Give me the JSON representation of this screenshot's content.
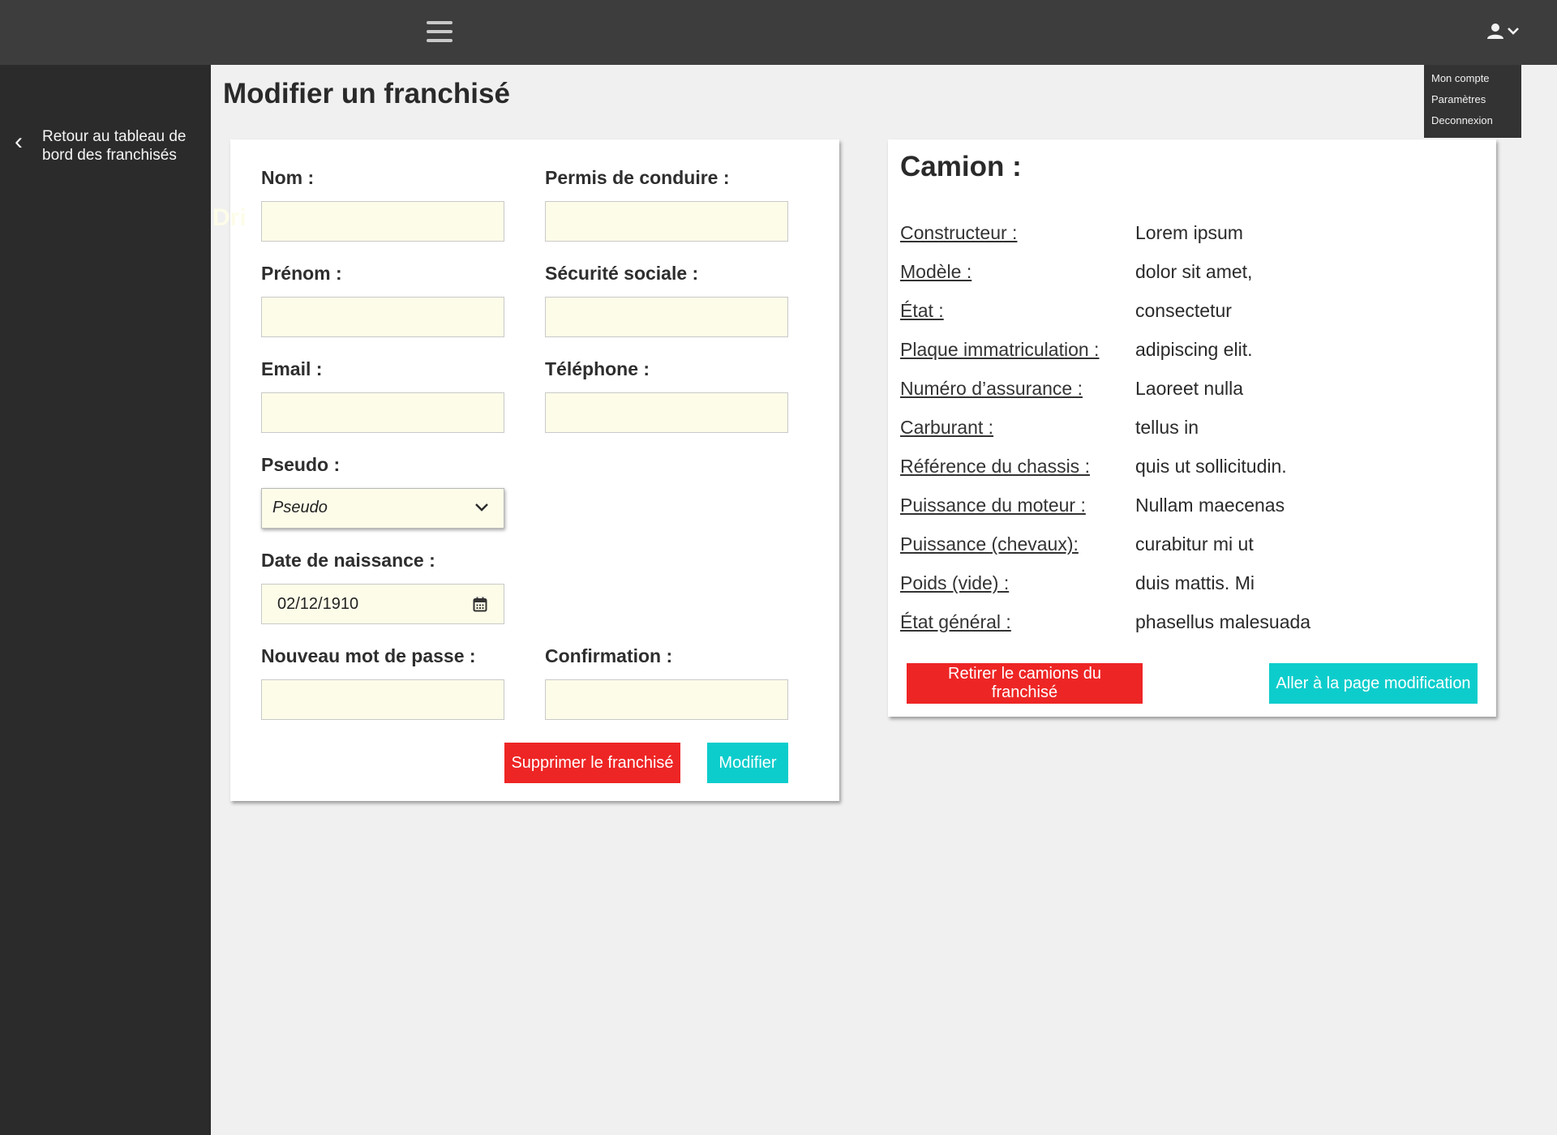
{
  "header": {
    "menu_icon": "hamburger-menu-icon",
    "account_icon": "user-icon"
  },
  "account_menu": {
    "items": [
      "Mon compte",
      "Paramètres",
      "Deconnexion"
    ]
  },
  "sidebar": {
    "back_icon": "chevron-left-icon",
    "back_link_line1": "Retour au tableau de",
    "back_link_line2": "bord des franchisés"
  },
  "page": {
    "title": "Modifier un franchisé",
    "ghost_text": "Dri"
  },
  "form": {
    "nom": {
      "label": "Nom :",
      "value": ""
    },
    "permis": {
      "label": "Permis de conduire :",
      "value": ""
    },
    "prenom": {
      "label": "Prénom :",
      "value": ""
    },
    "securite_sociale": {
      "label": "Sécurité sociale :",
      "value": ""
    },
    "email": {
      "label": "Email :",
      "value": ""
    },
    "telephone": {
      "label": "Téléphone :",
      "value": ""
    },
    "pseudo": {
      "label": "Pseudo :",
      "selected": "Pseudo"
    },
    "date_naissance": {
      "label": "Date de naissance :",
      "value": "02/12/1910"
    },
    "nouveau_mdp": {
      "label": "Nouveau mot de passe :",
      "value": ""
    },
    "confirmation": {
      "label": "Confirmation  :",
      "value": ""
    },
    "delete_label": "Supprimer le franchisé",
    "submit_label": "Modifier"
  },
  "truck": {
    "title": "Camion :",
    "specs": [
      {
        "label": "Constructeur :",
        "value": "Lorem ipsum"
      },
      {
        "label": "Modèle :",
        "value": "dolor sit amet,"
      },
      {
        "label": "État :",
        "value": "consectetur"
      },
      {
        "label": "Plaque immatriculation :",
        "value": "adipiscing elit."
      },
      {
        "label": "Numéro d’assurance :",
        "value": "Laoreet nulla"
      },
      {
        "label": "Carburant :",
        "value": "tellus in"
      },
      {
        "label": "Référence du chassis :",
        "value": "quis ut sollicitudin."
      },
      {
        "label": "Puissance du moteur :",
        "value": "Nullam maecenas"
      },
      {
        "label": "Puissance (chevaux):",
        "value": "curabitur mi ut"
      },
      {
        "label": "Poids (vide) :",
        "value": "duis mattis. Mi"
      },
      {
        "label": "État général :",
        "value": "phasellus malesuada"
      }
    ],
    "remove_label": "Retirer le camions du franchisé",
    "edit_page_label": "Aller à la page modification"
  },
  "colors": {
    "danger": "#ee2525",
    "accent": "#0dcdcc",
    "input_bg": "#fdfce9",
    "topbar": "#3d3d3d",
    "sidebar": "#2b2b2b"
  }
}
